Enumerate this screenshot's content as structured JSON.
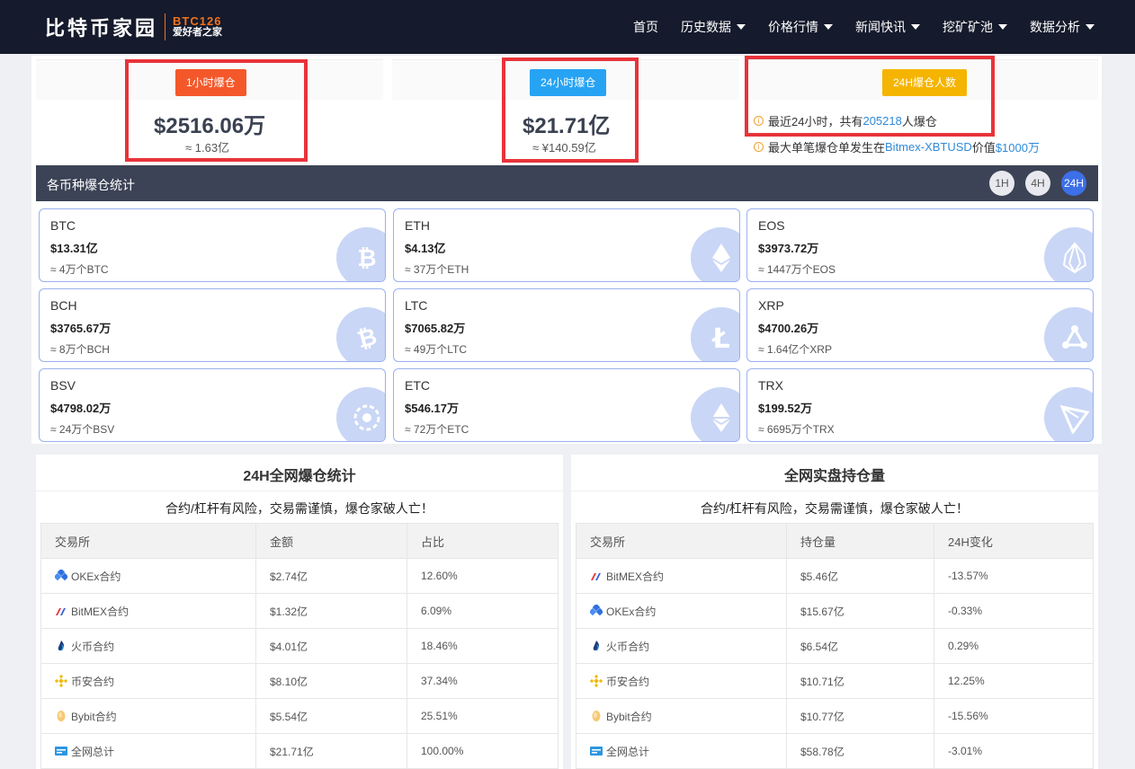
{
  "nav": {
    "logo_cn": "比特币家园",
    "logo_en": "BTC126",
    "logo_tagline": "爱好者之家",
    "items": [
      {
        "label": "首页",
        "dropdown": false
      },
      {
        "label": "历史数据",
        "dropdown": true
      },
      {
        "label": "价格行情",
        "dropdown": true
      },
      {
        "label": "新闻快讯",
        "dropdown": true
      },
      {
        "label": "挖矿矿池",
        "dropdown": true
      },
      {
        "label": "数据分析",
        "dropdown": true
      }
    ]
  },
  "stats": {
    "hour1": {
      "badge": "1小时爆仓",
      "value": "$2516.06万",
      "approx": "≈ 1.63亿",
      "badge_color": "#f4582a"
    },
    "hour24": {
      "badge": "24小时爆仓",
      "value": "$21.71亿",
      "approx": "≈ ¥140.59亿",
      "badge_color": "#27a3f4"
    },
    "people": {
      "badge": "24H爆仓人数",
      "badge_color": "#f5b400",
      "line1_pre": "最近24小时，共有",
      "line1_num": "205218",
      "line1_post": "人爆仓",
      "line2_pre": "最大单笔爆仓单发生在",
      "line2_ex": "Bitmex-XBTUSD",
      "line2_mid": "价值",
      "line2_val": "$1000万"
    }
  },
  "coins_section": {
    "title": "各币种爆仓统计",
    "timeframes": [
      "1H",
      "4H",
      "24H"
    ],
    "active_timeframe": "24H",
    "coins": [
      {
        "name": "BTC",
        "amount": "$13.31亿",
        "sub": "≈ 4万个BTC",
        "icon": "bitcoin-icon"
      },
      {
        "name": "ETH",
        "amount": "$4.13亿",
        "sub": "≈ 37万个ETH",
        "icon": "ethereum-icon"
      },
      {
        "name": "EOS",
        "amount": "$3973.72万",
        "sub": "≈ 1447万个EOS",
        "icon": "eos-icon"
      },
      {
        "name": "BCH",
        "amount": "$3765.67万",
        "sub": "≈ 8万个BCH",
        "icon": "bitcoin-cash-icon"
      },
      {
        "name": "LTC",
        "amount": "$7065.82万",
        "sub": "≈ 49万个LTC",
        "icon": "litecoin-icon"
      },
      {
        "name": "XRP",
        "amount": "$4700.26万",
        "sub": "≈ 1.64亿个XRP",
        "icon": "ripple-icon"
      },
      {
        "name": "BSV",
        "amount": "$4798.02万",
        "sub": "≈ 24万个BSV",
        "icon": "bsv-icon"
      },
      {
        "name": "ETC",
        "amount": "$546.17万",
        "sub": "≈ 72万个ETC",
        "icon": "ethereum-classic-icon"
      },
      {
        "name": "TRX",
        "amount": "$199.52万",
        "sub": "≈ 6695万个TRX",
        "icon": "tron-icon"
      }
    ]
  },
  "liquidation_table": {
    "title": "24H全网爆仓统计",
    "subtitle": "合约/杠杆有风险，交易需谨慎，爆仓家破人亡！",
    "headers": [
      "交易所",
      "金额",
      "占比"
    ],
    "rows": [
      {
        "exchange": "OKEx合约",
        "icon": "okex-icon",
        "amount": "$2.74亿",
        "ratio": "12.60%"
      },
      {
        "exchange": "BitMEX合约",
        "icon": "bitmex-icon",
        "amount": "$1.32亿",
        "ratio": "6.09%"
      },
      {
        "exchange": "火币合约",
        "icon": "huobi-icon",
        "amount": "$4.01亿",
        "ratio": "18.46%"
      },
      {
        "exchange": "币安合约",
        "icon": "binance-icon",
        "amount": "$8.10亿",
        "ratio": "37.34%"
      },
      {
        "exchange": "Bybit合约",
        "icon": "bybit-icon",
        "amount": "$5.54亿",
        "ratio": "25.51%"
      },
      {
        "exchange": "全网总计",
        "icon": "total-icon",
        "amount": "$21.71亿",
        "ratio": "100.00%"
      }
    ]
  },
  "position_table": {
    "title": "全网实盘持仓量",
    "subtitle": "合约/杠杆有风险，交易需谨慎，爆仓家破人亡！",
    "headers": [
      "交易所",
      "持仓量",
      "24H变化"
    ],
    "rows": [
      {
        "exchange": "BitMEX合约",
        "icon": "bitmex-icon",
        "amount": "$5.46亿",
        "change": "-13.57%"
      },
      {
        "exchange": "OKEx合约",
        "icon": "okex-icon",
        "amount": "$15.67亿",
        "change": "-0.33%"
      },
      {
        "exchange": "火币合约",
        "icon": "huobi-icon",
        "amount": "$6.54亿",
        "change": "0.29%"
      },
      {
        "exchange": "币安合约",
        "icon": "binance-icon",
        "amount": "$10.71亿",
        "change": "12.25%"
      },
      {
        "exchange": "Bybit合约",
        "icon": "bybit-icon",
        "amount": "$10.77亿",
        "change": "-15.56%"
      },
      {
        "exchange": "全网总计",
        "icon": "total-icon",
        "amount": "$58.78亿",
        "change": "-3.01%"
      }
    ]
  }
}
